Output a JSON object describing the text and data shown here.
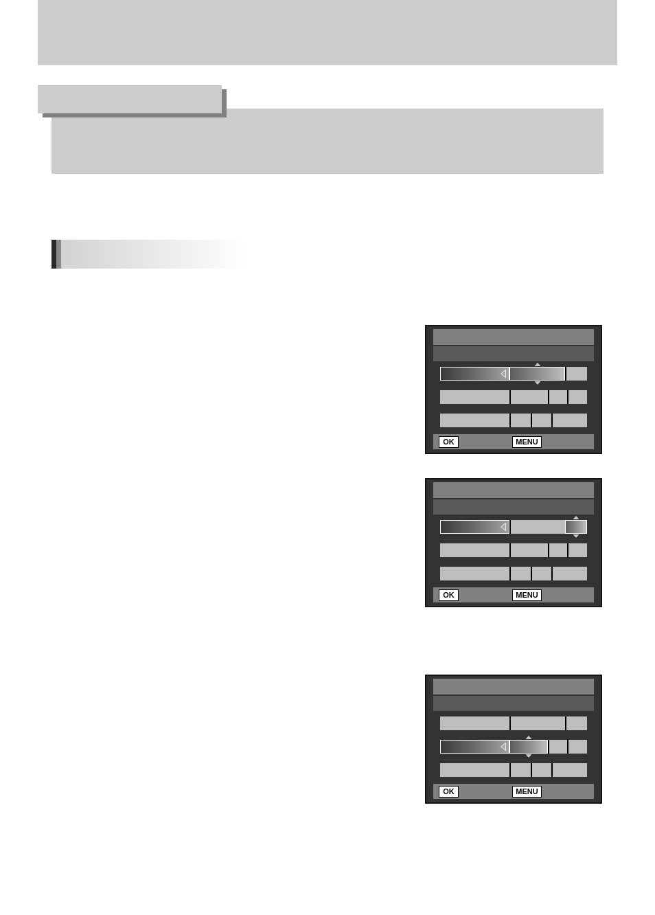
{
  "screens": [
    {
      "rows": [
        {
          "selected": true,
          "values": [
            {
              "selected": true
            },
            {
              "selected": false
            }
          ]
        },
        {
          "selected": false,
          "values": [
            {
              "selected": false
            },
            {
              "selected": false
            },
            {
              "selected": false
            }
          ]
        },
        {
          "selected": false,
          "values": [
            {
              "selected": false
            },
            {
              "selected": false
            },
            {
              "selected": false
            }
          ]
        }
      ],
      "buttons": [
        {
          "label": "OK"
        },
        {
          "label": "MENU"
        }
      ]
    },
    {
      "rows": [
        {
          "selected": true,
          "values": [
            {
              "selected": false
            },
            {
              "selected": true
            }
          ]
        },
        {
          "selected": false,
          "values": [
            {
              "selected": false
            },
            {
              "selected": false
            },
            {
              "selected": false
            }
          ]
        },
        {
          "selected": false,
          "values": [
            {
              "selected": false
            },
            {
              "selected": false
            },
            {
              "selected": false
            }
          ]
        }
      ],
      "buttons": [
        {
          "label": "OK"
        },
        {
          "label": "MENU"
        }
      ]
    },
    {
      "rows": [
        {
          "selected": false,
          "values": [
            {
              "selected": false
            },
            {
              "selected": false
            }
          ]
        },
        {
          "selected": true,
          "values": [
            {
              "selected": true
            },
            {
              "selected": false
            },
            {
              "selected": false
            }
          ]
        },
        {
          "selected": false,
          "values": [
            {
              "selected": false
            },
            {
              "selected": false
            },
            {
              "selected": false
            }
          ]
        }
      ],
      "buttons": [
        {
          "label": "OK"
        },
        {
          "label": "MENU"
        }
      ]
    }
  ]
}
